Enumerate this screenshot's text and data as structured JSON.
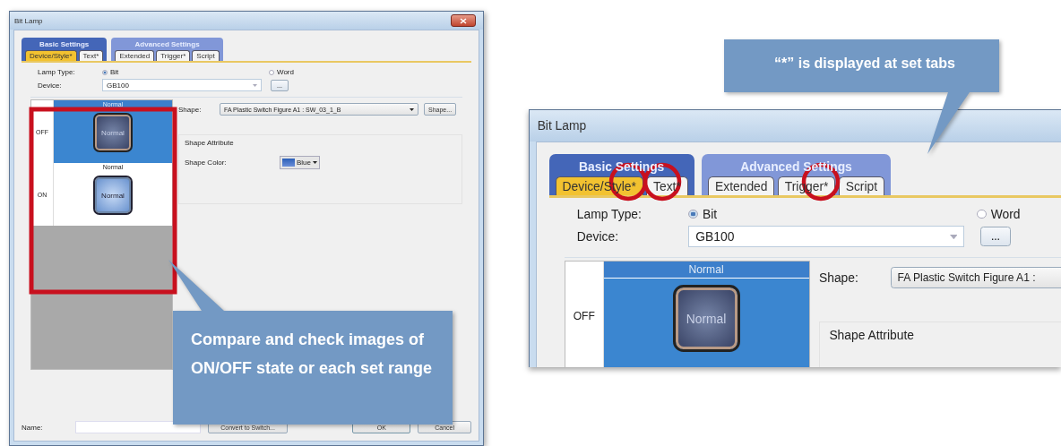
{
  "windows": [
    {
      "kind": "full",
      "title": "Bit Lamp",
      "close_button": true,
      "tab_groups": [
        {
          "label": "Basic Settings",
          "tabs": [
            {
              "label": "Device/Style*",
              "selected": true
            },
            {
              "label": "Text*",
              "selected": false
            }
          ]
        },
        {
          "label": "Advanced Settings",
          "tabs": [
            {
              "label": "Extended",
              "selected": false
            },
            {
              "label": "Trigger*",
              "selected": false
            },
            {
              "label": "Script",
              "selected": false
            }
          ]
        }
      ],
      "lamp_type": {
        "label": "Lamp Type:",
        "options": [
          {
            "label": "Bit",
            "selected": true
          },
          {
            "label": "Word",
            "selected": false
          }
        ]
      },
      "device": {
        "label": "Device:",
        "value": "GB100",
        "browse_button": "..."
      },
      "states": [
        {
          "label": "OFF",
          "header": "Normal",
          "lamp": "Normal",
          "kind": "off",
          "selected": true
        },
        {
          "label": "ON",
          "header": "Normal",
          "lamp": "Normal",
          "kind": "on",
          "selected": false
        }
      ],
      "shape": {
        "label": "Shape:",
        "value": "FA Plastic Switch Figure A1 : SW_03_1_B",
        "button": "Shape..."
      },
      "shape_attribute": {
        "title": "Shape Attribute",
        "color_label": "Shape Color:",
        "color_value": "Blue"
      },
      "footer": {
        "name_label": "Name:",
        "convert_button": "Convert to Switch...",
        "ok_button": "OK",
        "cancel_button": "Cancel"
      }
    },
    {
      "kind": "detail",
      "title": "Bit Lamp",
      "tab_groups": [
        {
          "label": "Basic Settings",
          "tabs": [
            {
              "label": "Device/Style*",
              "selected": true
            },
            {
              "label": "Text*",
              "selected": false
            }
          ]
        },
        {
          "label": "Advanced Settings",
          "tabs": [
            {
              "label": "Extended",
              "selected": false
            },
            {
              "label": "Trigger*",
              "selected": false
            },
            {
              "label": "Script",
              "selected": false
            }
          ]
        }
      ],
      "lamp_type": {
        "label": "Lamp Type:",
        "options": [
          {
            "label": "Bit",
            "selected": true
          },
          {
            "label": "Word",
            "selected": false
          }
        ]
      },
      "device": {
        "label": "Device:",
        "value": "GB100",
        "browse_button": "..."
      },
      "states": [
        {
          "label": "OFF",
          "header": "Normal",
          "lamp": "Normal",
          "kind": "off",
          "selected": true
        }
      ],
      "shape": {
        "label": "Shape:",
        "value": "FA Plastic Switch Figure A1 :"
      },
      "shape_attribute": {
        "title": "Shape Attribute"
      }
    }
  ],
  "callouts": [
    {
      "text": "Compare and check images of ON/OFF state or each set range"
    },
    {
      "text": "“*” is displayed at set tabs"
    }
  ]
}
